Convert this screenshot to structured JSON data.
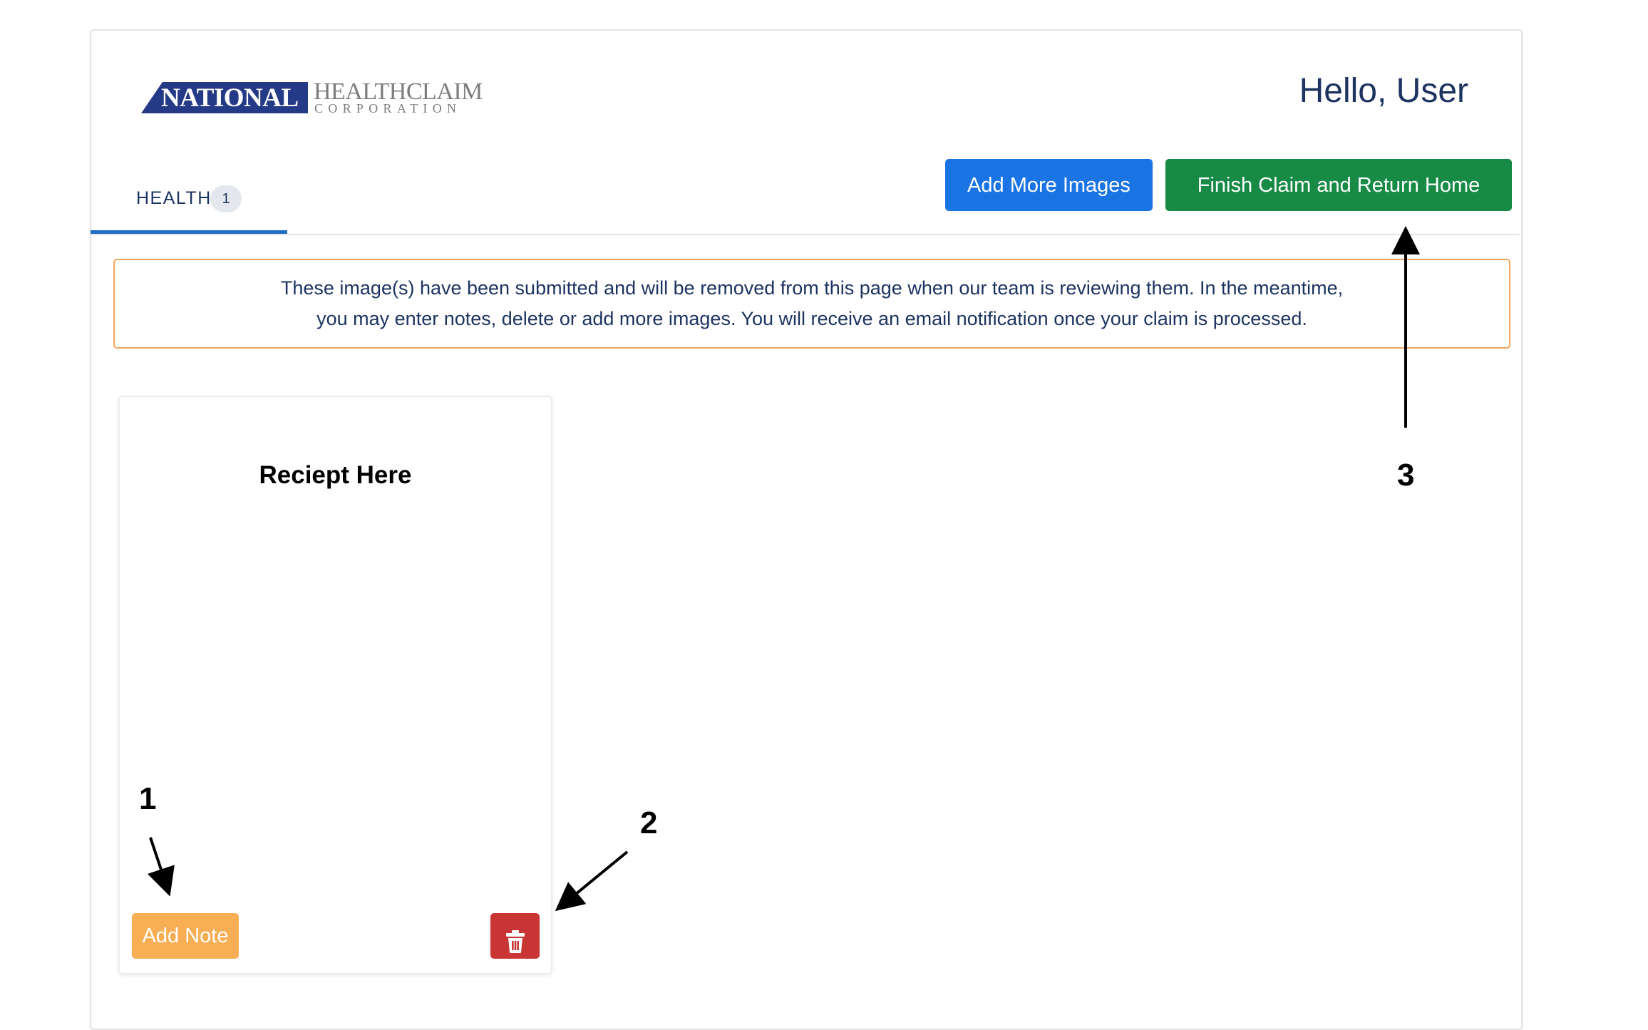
{
  "logo": {
    "national": "NATIONAL",
    "healthclaim": "HEALTHCLAIM",
    "corporation": "CORPORATION",
    "colors": {
      "navy": "#253a86",
      "gray": "#7d7d7d"
    }
  },
  "header": {
    "greeting": "Hello, User"
  },
  "tabs": [
    {
      "label": "HEALTH",
      "count": "1",
      "active": true
    }
  ],
  "actions": {
    "add_more_images": "Add More Images",
    "finish_claim": "Finish Claim and Return Home"
  },
  "notice": {
    "line1": "These image(s) have been submitted and will be removed from this page when our team is reviewing them. In the meantime,",
    "line2": "you may enter notes, delete or add more images. You will receive an email notification once your claim is processed."
  },
  "receipt_card": {
    "title": "Reciept Here",
    "add_note_label": "Add Note",
    "delete_icon": "trash-icon"
  },
  "annotations": [
    "1",
    "2",
    "3"
  ],
  "colors": {
    "primary_blue": "#1b74e4",
    "success_green": "#178a45",
    "warning_orange": "#f8ae55",
    "danger_red": "#c93434",
    "notice_border": "#f5a55c",
    "text_navy": "#1d3461"
  }
}
